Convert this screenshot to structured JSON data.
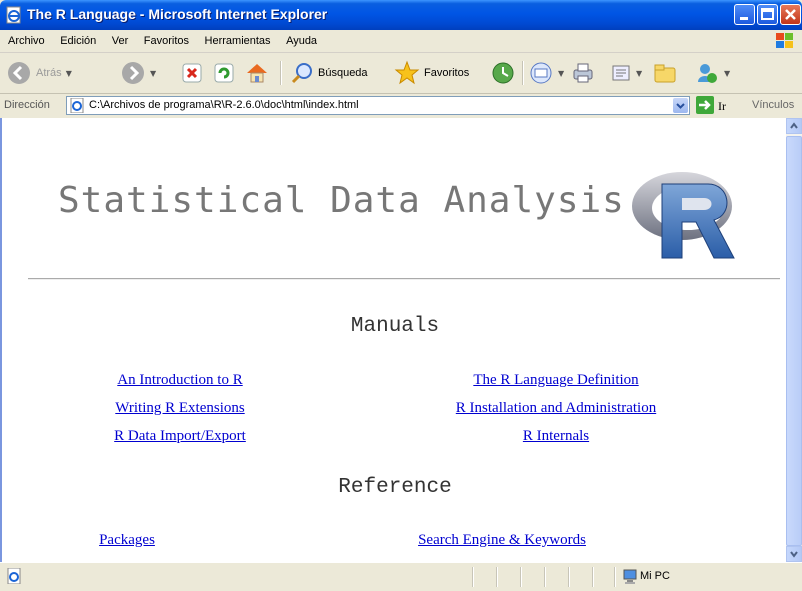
{
  "window": {
    "title": "The R Language - Microsoft Internet Explorer"
  },
  "menu": [
    "Archivo",
    "Edición",
    "Ver",
    "Favoritos",
    "Herramientas",
    "Ayuda"
  ],
  "toolbar": {
    "back_label": "Atrás",
    "search_label": "Búsqueda",
    "favorites_label": "Favoritos"
  },
  "address": {
    "label": "Dirección",
    "value": "C:\\Archivos de programa\\R\\R-2.6.0\\doc\\html\\index.html",
    "go_label": "Ir",
    "links_label": "Vínculos"
  },
  "page": {
    "heading": "Statistical Data Analysis",
    "manuals": {
      "heading": "Manuals",
      "links": [
        "An Introduction to R",
        "The R Language Definition",
        "Writing R Extensions",
        "R Installation and Administration",
        "R Data Import/Export",
        "R Internals"
      ]
    },
    "reference": {
      "heading": "Reference",
      "links": [
        "Packages",
        "Search Engine & Keywords"
      ]
    }
  },
  "status": {
    "zone": "Mi PC"
  },
  "colors": {
    "titlebar": "#0055e5",
    "link": "#0000d0",
    "heading_gray": "#777777"
  }
}
